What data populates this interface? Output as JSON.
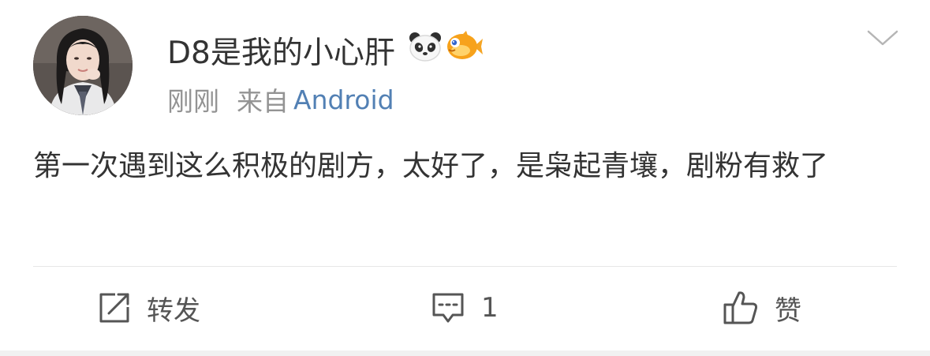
{
  "post": {
    "author": {
      "name": "D8是我的小心肝",
      "badges": [
        "panda-badge-icon",
        "fish-badge-icon"
      ]
    },
    "time": "刚刚",
    "source_label": "来自",
    "source_app": "Android",
    "text": "第一次遇到这么积极的剧方，太好了，是枭起青壤，剧粉有救了"
  },
  "actions": {
    "repost": {
      "icon": "edit-share-icon",
      "label": "转发"
    },
    "comment": {
      "icon": "comment-icon",
      "count": "1"
    },
    "like": {
      "icon": "thumbs-up-icon",
      "label": "赞"
    }
  },
  "colors": {
    "text": "#333333",
    "meta": "#939393",
    "link": "#5280b4",
    "divider": "#e7e7e7"
  }
}
